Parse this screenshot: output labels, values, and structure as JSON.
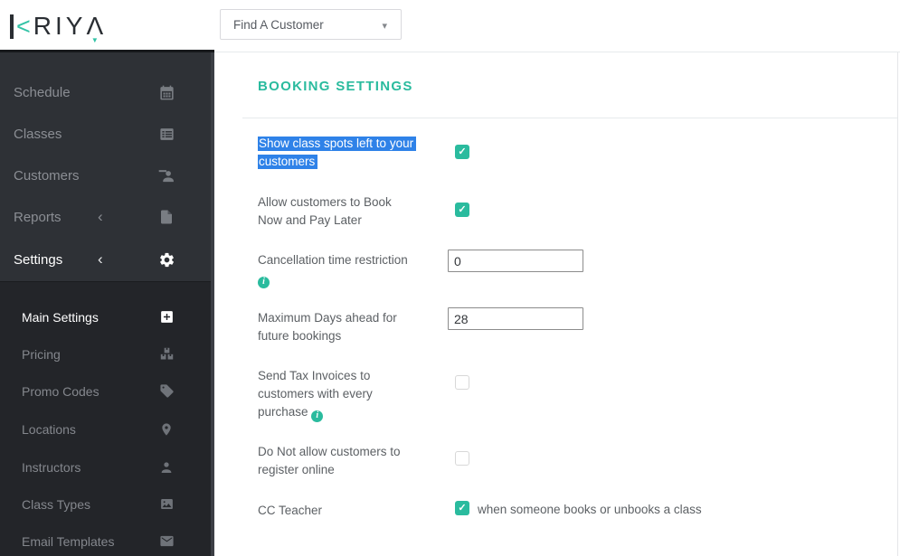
{
  "brand": {
    "k_angle": "<",
    "letters": "RIY",
    "last_letter": "Λ",
    "triangle": "▼"
  },
  "header": {
    "dropdown_label": "Find A Customer",
    "dropdown_caret": "▾"
  },
  "sidebar": {
    "chevron": "‹",
    "items": [
      {
        "label": "Schedule"
      },
      {
        "label": "Classes"
      },
      {
        "label": "Customers"
      },
      {
        "label": "Reports"
      },
      {
        "label": "Settings"
      }
    ],
    "subitems": [
      {
        "label": "Main Settings"
      },
      {
        "label": "Pricing"
      },
      {
        "label": "Promo Codes"
      },
      {
        "label": "Locations"
      },
      {
        "label": "Instructors"
      },
      {
        "label": "Class Types"
      },
      {
        "label": "Email Templates"
      }
    ]
  },
  "main": {
    "title": "BOOKING SETTINGS",
    "settings": [
      {
        "label_line1": "Show class spots left to your",
        "label_line2": "customers",
        "control": "checkbox",
        "checked": true,
        "highlighted": true
      },
      {
        "label_line1": "Allow customers to Book",
        "label_line2": "Now and Pay Later",
        "control": "checkbox",
        "checked": true
      },
      {
        "label_line1": "Cancellation time restriction",
        "control": "input",
        "value": "0",
        "has_info": true
      },
      {
        "label_line1": "Maximum Days ahead for",
        "label_line2": "future bookings",
        "control": "input",
        "value": "28"
      },
      {
        "label_line1": "Send Tax Invoices to",
        "label_line2": "customers with every",
        "label_line3": "purchase",
        "control": "checkbox",
        "checked": false,
        "has_info": true
      },
      {
        "label_line1": "Do Not allow customers to",
        "label_line2": "register online",
        "control": "checkbox",
        "checked": false
      },
      {
        "label_line1": "CC Teacher",
        "control": "checkbox",
        "checked": true,
        "suffix": "when someone books or unbooks a class"
      }
    ]
  },
  "glyphs": {
    "check": "✓",
    "info": "i"
  },
  "colors": {
    "accent": "#2abb9e",
    "selection": "#2f82e8",
    "sidebar_bg": "#2e3136",
    "submenu_bg": "#232529",
    "divider": "#e7eaec"
  }
}
